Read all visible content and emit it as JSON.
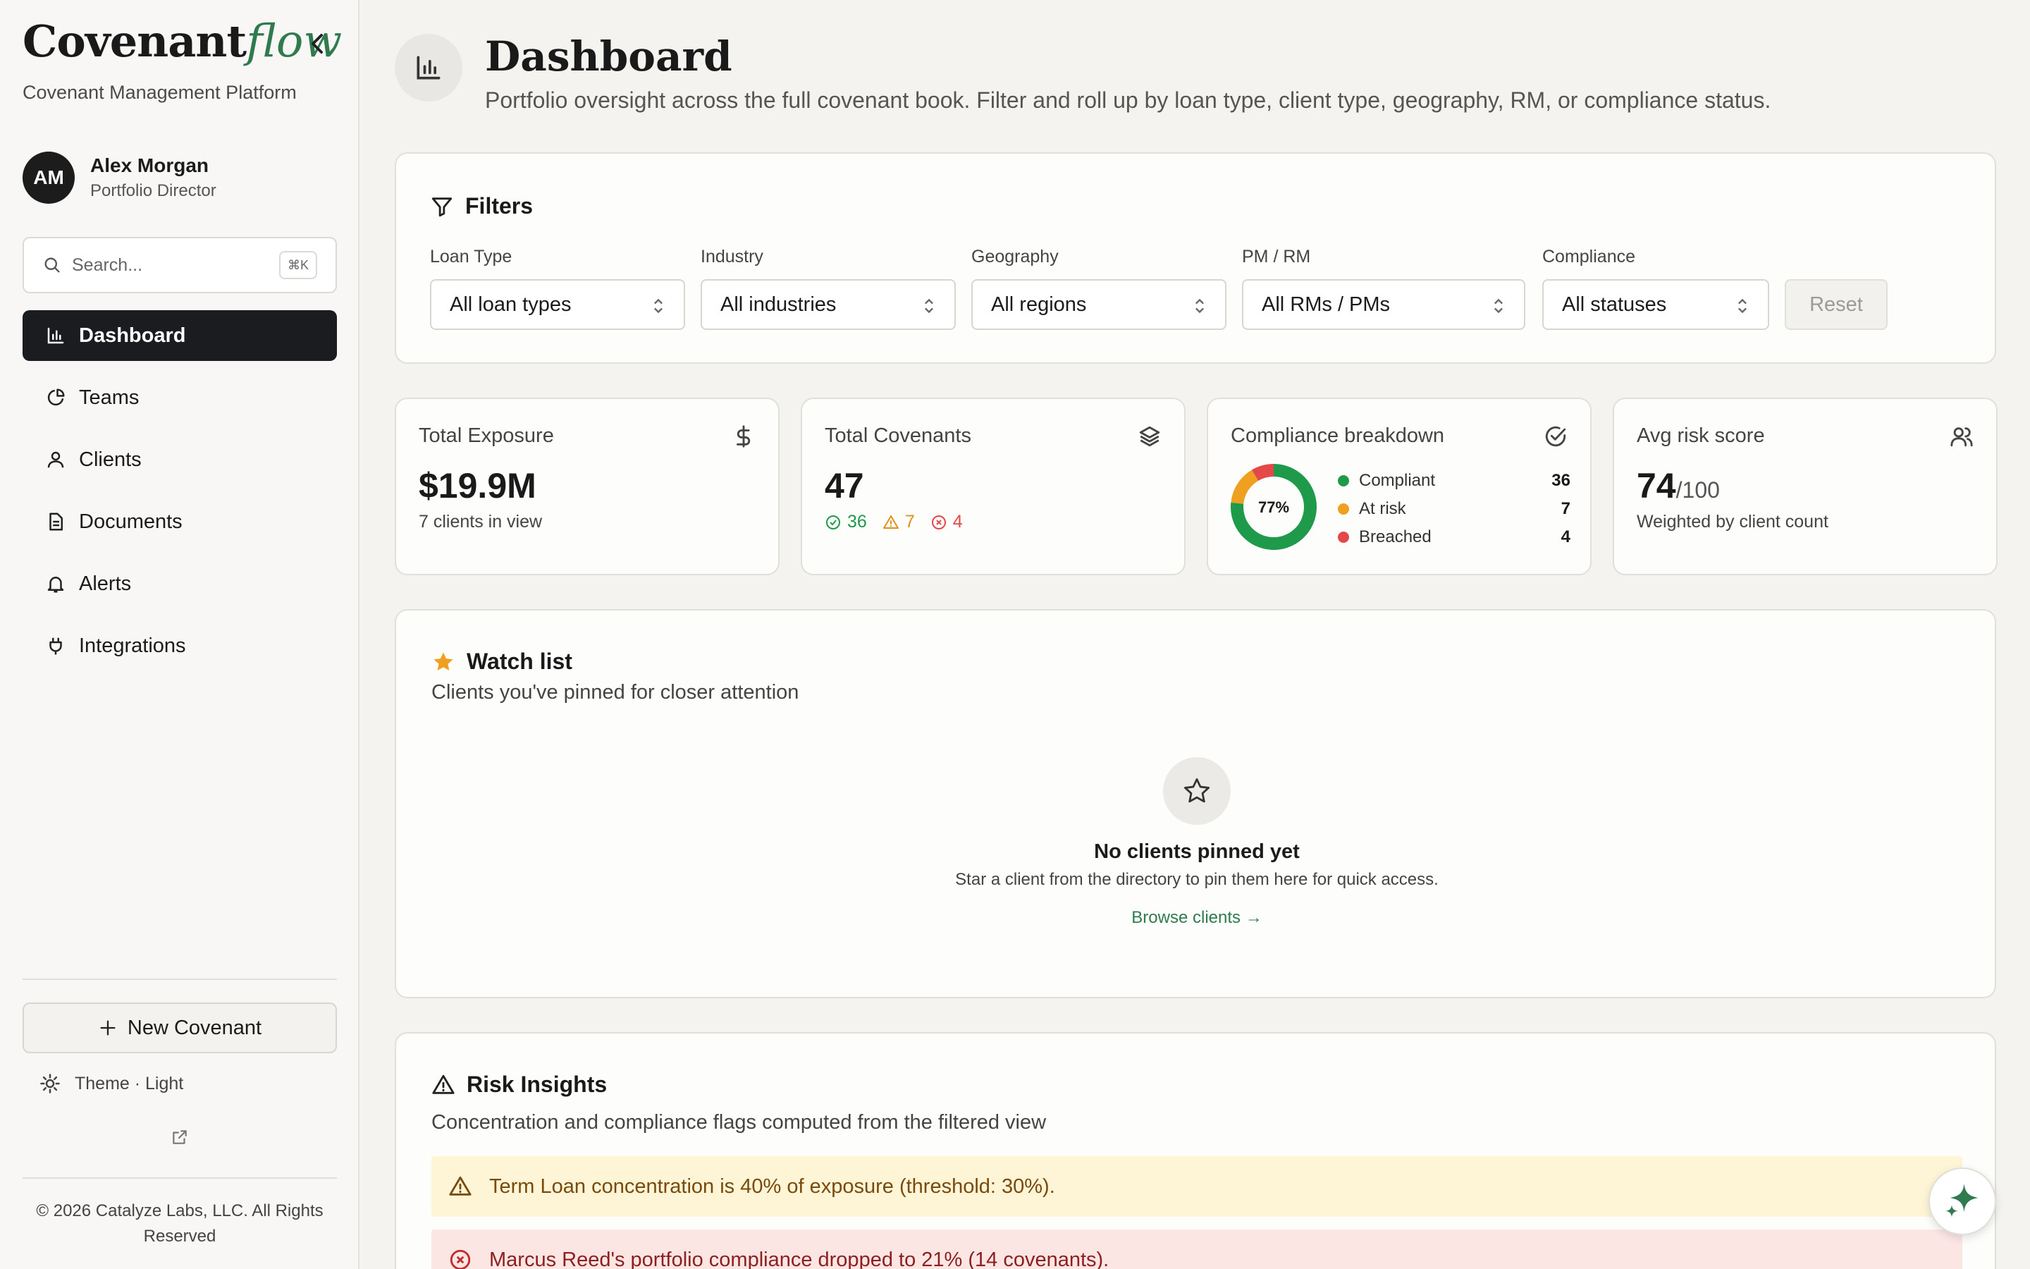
{
  "brand": {
    "main": "Covenant",
    "accent": "flow",
    "subtitle": "Covenant Management Platform"
  },
  "user": {
    "initials": "AM",
    "name": "Alex Morgan",
    "role": "Portfolio Director"
  },
  "search": {
    "placeholder": "Search...",
    "shortcut": "⌘K"
  },
  "nav": [
    {
      "label": "Dashboard",
      "icon": "bar-chart-icon",
      "active": true
    },
    {
      "label": "Teams",
      "icon": "pie-chart-icon"
    },
    {
      "label": "Clients",
      "icon": "user-icon"
    },
    {
      "label": "Documents",
      "icon": "document-icon"
    },
    {
      "label": "Alerts",
      "icon": "bell-icon"
    },
    {
      "label": "Integrations",
      "icon": "plug-icon"
    }
  ],
  "sidebar_footer": {
    "new_covenant": "New Covenant",
    "theme": "Theme · Light",
    "copyright": "© 2026 Catalyze Labs, LLC. All Rights Reserved"
  },
  "page": {
    "title": "Dashboard",
    "subtitle": "Portfolio oversight across the full covenant book. Filter and roll up by loan type, client type, geography, RM, or compliance status."
  },
  "filters": {
    "title": "Filters",
    "fields": [
      {
        "label": "Loan Type",
        "value": "All loan types"
      },
      {
        "label": "Industry",
        "value": "All industries"
      },
      {
        "label": "Geography",
        "value": "All regions"
      },
      {
        "label": "PM / RM",
        "value": "All RMs / PMs"
      },
      {
        "label": "Compliance",
        "value": "All statuses"
      }
    ],
    "reset": "Reset"
  },
  "stats": {
    "exposure": {
      "label": "Total Exposure",
      "value": "$19.9M",
      "note": "7 clients in view",
      "icon": "dollar-icon"
    },
    "covenants": {
      "label": "Total Covenants",
      "value": "47",
      "compliant": "36",
      "at_risk": "7",
      "breached": "4",
      "icon": "layers-icon"
    },
    "compliance": {
      "label": "Compliance breakdown",
      "percent": "77%",
      "icon": "check-circle-icon",
      "items": [
        {
          "label": "Compliant",
          "value": "36",
          "count": 36,
          "color": "#1e9a4a"
        },
        {
          "label": "At risk",
          "value": "7",
          "count": 7,
          "color": "#f0a020"
        },
        {
          "label": "Breached",
          "value": "4",
          "count": 4,
          "color": "#e54848"
        }
      ]
    },
    "risk": {
      "label": "Avg risk score",
      "value": "74",
      "suffix": "/100",
      "note": "Weighted by client count",
      "icon": "users-icon"
    }
  },
  "watchlist": {
    "title": "Watch list",
    "subtitle": "Clients you've pinned for closer attention",
    "empty_title": "No clients pinned yet",
    "empty_sub": "Star a client from the directory to pin them here for quick access.",
    "browse": "Browse clients →"
  },
  "risk_insights": {
    "title": "Risk Insights",
    "subtitle": "Concentration and compliance flags computed from the filtered view",
    "alerts": [
      {
        "type": "warning",
        "text": "Term Loan concentration is 40% of exposure (threshold: 30%)."
      },
      {
        "type": "error",
        "text": "Marcus Reed's portfolio compliance dropped to 21% (14 covenants)."
      }
    ]
  },
  "colors": {
    "accent": "#2f7a4f",
    "compliant": "#1e9a4a",
    "at_risk": "#f0a020",
    "breached": "#e54848",
    "nav_active": "#1a1c20"
  }
}
